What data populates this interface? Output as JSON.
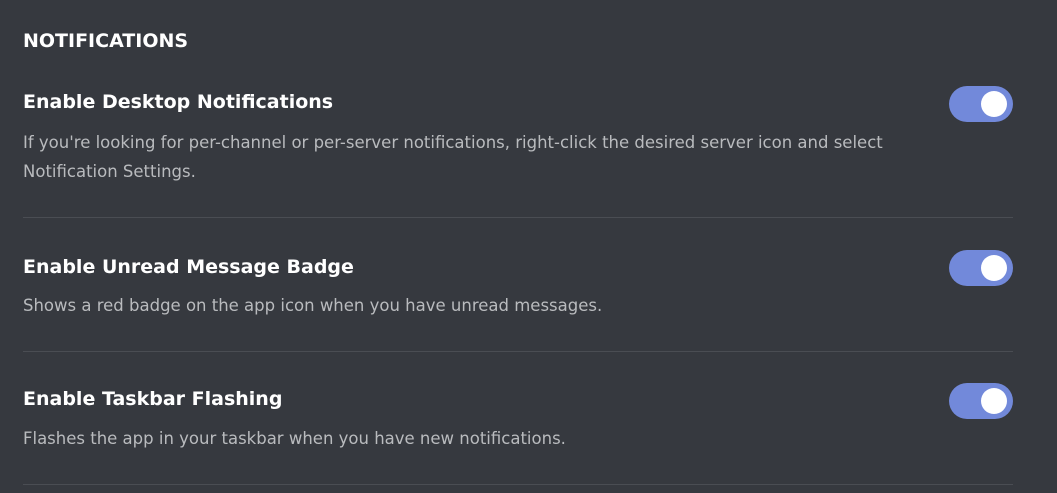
{
  "section": {
    "title": "NOTIFICATIONS"
  },
  "settings": [
    {
      "title": "Enable Desktop Notifications",
      "description": "If you're looking for per-channel or per-server notifications, right-click the desired server icon and select Notification Settings.",
      "enabled": true
    },
    {
      "title": "Enable Unread Message Badge",
      "description": "Shows a red badge on the app icon when you have unread messages.",
      "enabled": true
    },
    {
      "title": "Enable Taskbar Flashing",
      "description": "Flashes the app in your taskbar when you have new notifications.",
      "enabled": true
    }
  ],
  "colors": {
    "background": "#36393f",
    "toggle_on": "#7289da",
    "title_text": "#ffffff",
    "description_text": "#b9bbbe",
    "divider": "#4a4d53"
  }
}
